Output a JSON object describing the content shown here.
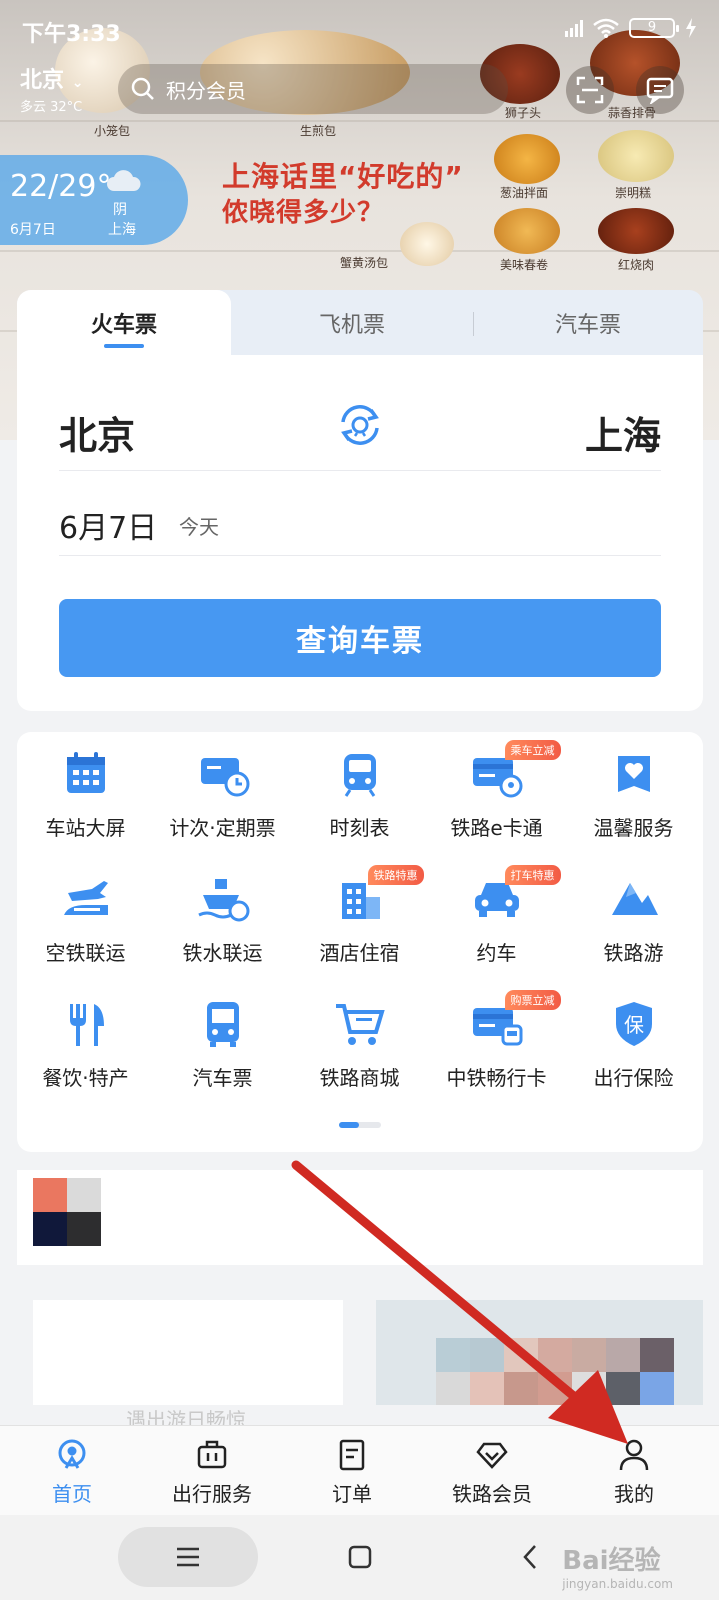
{
  "status_bar": {
    "time": "下午3:33",
    "battery": "9",
    "hd": "HD"
  },
  "header": {
    "city": "北京",
    "weather_line": "多云 32°C",
    "search_placeholder": "积分会员"
  },
  "weather_card": {
    "temp": "22/29°",
    "date": "6月7日",
    "condition": "阴",
    "location": "上海"
  },
  "banner": {
    "title_line1": "上海话里“好吃的”",
    "title_line2": "侬晓得多少？",
    "foods": [
      "小笼包",
      "生煎包",
      "狮子头",
      "蒜香排骨",
      "葱油拌面",
      "崇明糕",
      "蟹黄汤包",
      "美味春卷",
      "红烧肉"
    ]
  },
  "ticket_tabs": [
    "火车票",
    "飞机票",
    "汽车票"
  ],
  "ticket": {
    "from": "北京",
    "to": "上海",
    "date": "6月7日",
    "date_note": "今天",
    "query_label": "查询车票"
  },
  "services": [
    {
      "label": "车站大屏",
      "icon": "calendar-grid-icon",
      "badge": ""
    },
    {
      "label": "计次·定期票",
      "icon": "ticket-clock-icon",
      "badge": ""
    },
    {
      "label": "时刻表",
      "icon": "train-front-icon",
      "badge": ""
    },
    {
      "label": "铁路e卡通",
      "icon": "card-train-icon",
      "badge": "乘车立减"
    },
    {
      "label": "温馨服务",
      "icon": "heart-box-icon",
      "badge": ""
    },
    {
      "label": "空铁联运",
      "icon": "plane-train-icon",
      "badge": ""
    },
    {
      "label": "铁水联运",
      "icon": "ship-train-icon",
      "badge": ""
    },
    {
      "label": "酒店住宿",
      "icon": "hotel-building-icon",
      "badge": "铁路特惠"
    },
    {
      "label": "约车",
      "icon": "car-icon",
      "badge": "打车特惠"
    },
    {
      "label": "铁路游",
      "icon": "mountain-icon",
      "badge": ""
    },
    {
      "label": "餐饮·特产",
      "icon": "fork-knife-icon",
      "badge": ""
    },
    {
      "label": "汽车票",
      "icon": "bus-icon",
      "badge": ""
    },
    {
      "label": "铁路商城",
      "icon": "cart-icon",
      "badge": ""
    },
    {
      "label": "中铁畅行卡",
      "icon": "card-rail-icon",
      "badge": "购票立减"
    },
    {
      "label": "出行保险",
      "icon": "shield-bao-icon",
      "badge": ""
    }
  ],
  "bottom_nav": [
    "首页",
    "出行服务",
    "订单",
    "铁路会员",
    "我的"
  ],
  "promo_text": "遇出游日畅惊",
  "watermark": {
    "main": "Bai经验",
    "sub": "jingyan.baidu.com"
  },
  "colors": {
    "accent": "#3d8ff0",
    "button": "#4798f2",
    "badge": "#f25b45",
    "arrow": "#d02a22"
  }
}
